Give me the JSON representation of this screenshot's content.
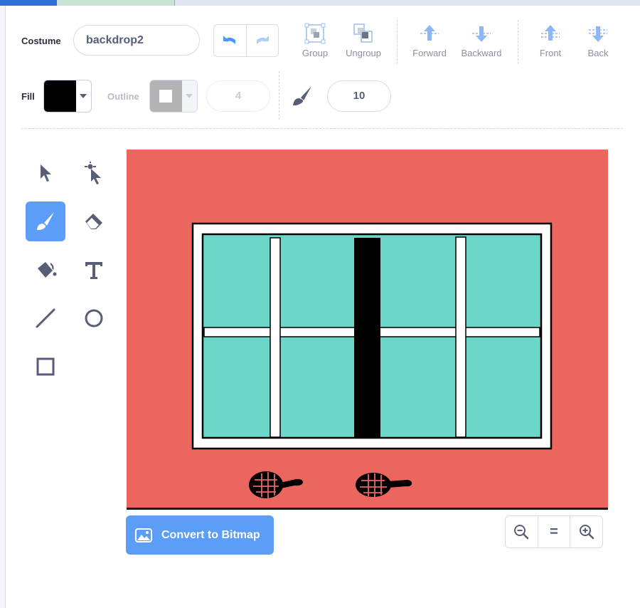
{
  "costume": {
    "label": "Costume",
    "name": "backdrop2"
  },
  "toolbar": {
    "undo_icon": "undo-icon",
    "redo_icon": "redo-icon",
    "group": "Group",
    "ungroup": "Ungroup",
    "forward": "Forward",
    "backward": "Backward",
    "front": "Front",
    "back": "Back"
  },
  "style": {
    "fill_label": "Fill",
    "fill_color": "#000000",
    "outline_label": "Outline",
    "outline_color": "#ffffff",
    "outline_width": "4",
    "brush_size": "10"
  },
  "tools": [
    "select",
    "reshape",
    "brush",
    "eraser",
    "fill",
    "text",
    "line",
    "circle",
    "rectangle"
  ],
  "active_tool": "brush",
  "colors": {
    "accent": "#5c9df7",
    "canvas_bg": "#ec6660",
    "glass": "#6cd6c9",
    "icon": "#575e75"
  },
  "footer": {
    "convert": "Convert to Bitmap",
    "zoom_out": "zoom-out-icon",
    "zoom_reset": "=",
    "zoom_in": "zoom-in-icon"
  }
}
